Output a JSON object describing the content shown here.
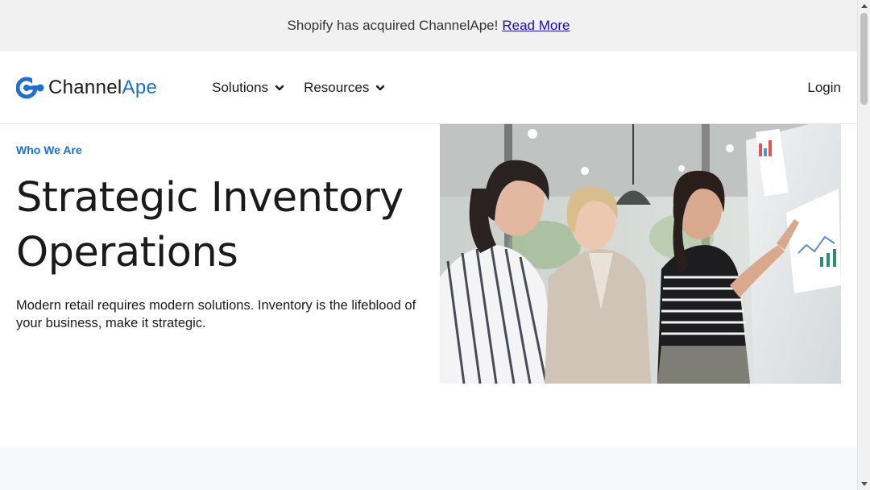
{
  "announcement": {
    "message": "Shopify has acquired ChannelApe!",
    "link_label": "Read More"
  },
  "header": {
    "logo": {
      "text_main": "Channel",
      "text_accent": "Ape"
    },
    "nav": [
      {
        "label": "Solutions",
        "icon": "chevron-down-icon"
      },
      {
        "label": "Resources",
        "icon": "chevron-down-icon"
      }
    ],
    "login_label": "Login"
  },
  "hero": {
    "eyebrow": "Who We Are",
    "title_line1": "Strategic Inventory",
    "title_line2": "Operations",
    "description": "Modern retail requires modern solutions. Inventory is the lifeblood of your business, make it strategic."
  },
  "colors": {
    "brand": "#1f6fd1",
    "announcement_bg": "#f1f1f1",
    "text": "#1a1a1a"
  }
}
